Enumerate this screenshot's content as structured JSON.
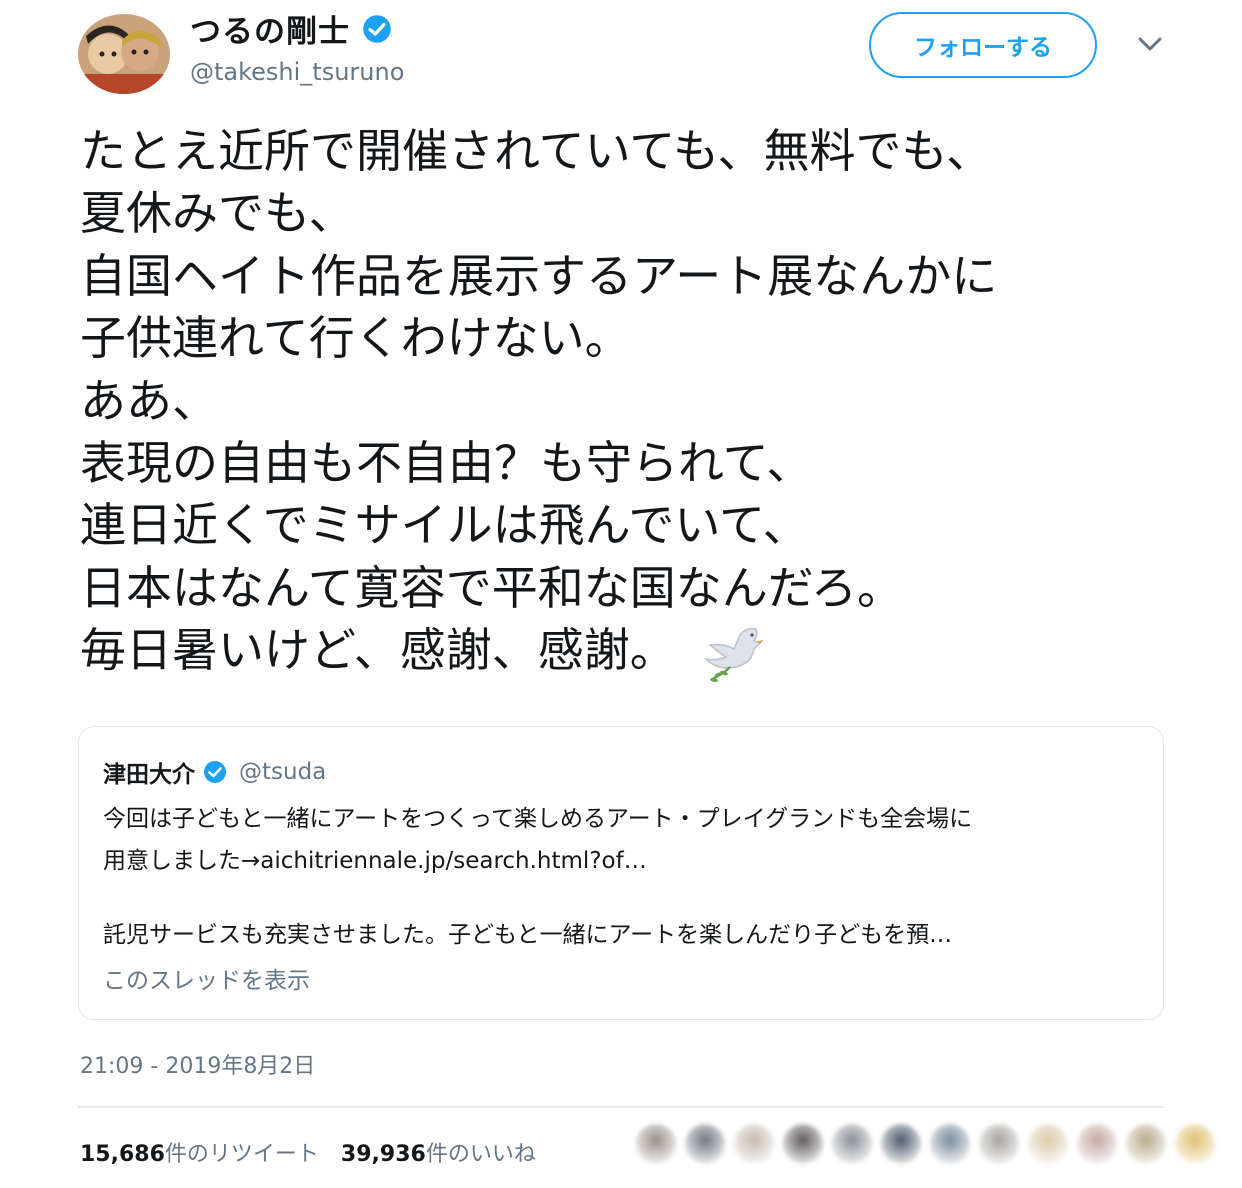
{
  "author": {
    "display_name": "つるの剛士",
    "handle": "@takeshi_tsuruno",
    "verified": true,
    "avatar_icon": "avatar-photo"
  },
  "follow_button": {
    "label": "フォローする"
  },
  "menu": {
    "icon": "chevron-down-icon"
  },
  "tweet": {
    "lines": [
      "たとえ近所で開催されていても、無料でも、",
      "夏休みでも、",
      "自国ヘイト作品を展示するアート展なんかに",
      "子供連れて行くわけない。",
      "ああ、",
      "表現の自由も不自由？も守られて、",
      "連日近くでミサイルは飛んでいて、",
      "日本はなんて寛容で平和な国なんだろ。",
      "毎日暑いけど、感謝、感謝。"
    ],
    "emoji": "dove-icon"
  },
  "quote": {
    "name": "津田大介",
    "handle": "@tsuda",
    "verified": true,
    "line1": "今回は子どもと一緒にアートをつくって楽しめるアート・プレイグランドも全会場に",
    "line2": "用意しました→aichitriennale.jp/search.html?of…",
    "line3": "託児サービスも充実させました。子どもと一緒にアートを楽しんだり子どもを預…",
    "show_thread": "このスレッドを表示"
  },
  "timestamp": "21:09 - 2019年8月2日",
  "stats": {
    "retweets_count": "15,686",
    "retweets_label": "件のリツイート",
    "likes_count": "39,936",
    "likes_label": "件のいいね"
  },
  "likers": {
    "note": "blurred avatars",
    "colors": [
      "#9a8f86",
      "#6f7680",
      "#c7b9ad",
      "#5f5a5d",
      "#8a8f96",
      "#4d5b6d",
      "#7a8c9e",
      "#a8a39b",
      "#d9c9a8",
      "#c4a9a2",
      "#b9aa8c",
      "#e0c070"
    ]
  },
  "colors": {
    "accent": "#1da1f2",
    "text": "#14171a",
    "secondary": "#657786",
    "border": "#e1e8ed"
  }
}
